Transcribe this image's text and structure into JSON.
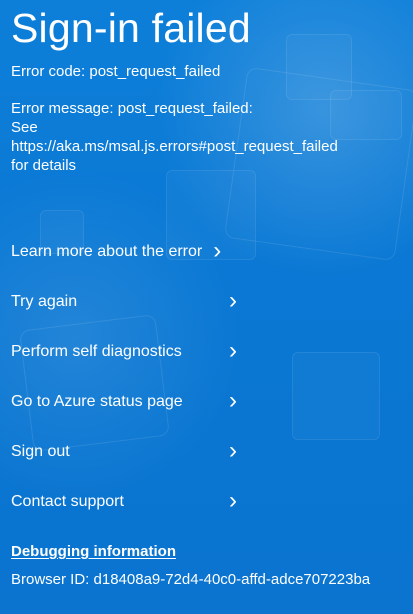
{
  "page": {
    "title": "Sign-in failed",
    "error_code": "Error code: post_request_failed",
    "error_message_lines": [
      "Error message: post_request_failed:",
      "See",
      "https://aka.ms/msal.js.errors#post_request_failed",
      "for details"
    ]
  },
  "actions": [
    {
      "label": "Learn more about the error",
      "icon": "chevron-right-icon"
    },
    {
      "label": "Try again",
      "icon": "chevron-right-icon"
    },
    {
      "label": "Perform self diagnostics",
      "icon": "chevron-right-icon"
    },
    {
      "label": "Go to Azure status page",
      "icon": "chevron-right-icon"
    },
    {
      "label": "Sign out",
      "icon": "chevron-right-icon"
    },
    {
      "label": "Contact support",
      "icon": "chevron-right-icon"
    }
  ],
  "debug": {
    "title": "Debugging information",
    "browser_id": "Browser ID: d18408a9-72d4-40c0-affd-adce707223ba"
  },
  "theme": {
    "background": "#0a78d4",
    "text": "#ffffff"
  }
}
